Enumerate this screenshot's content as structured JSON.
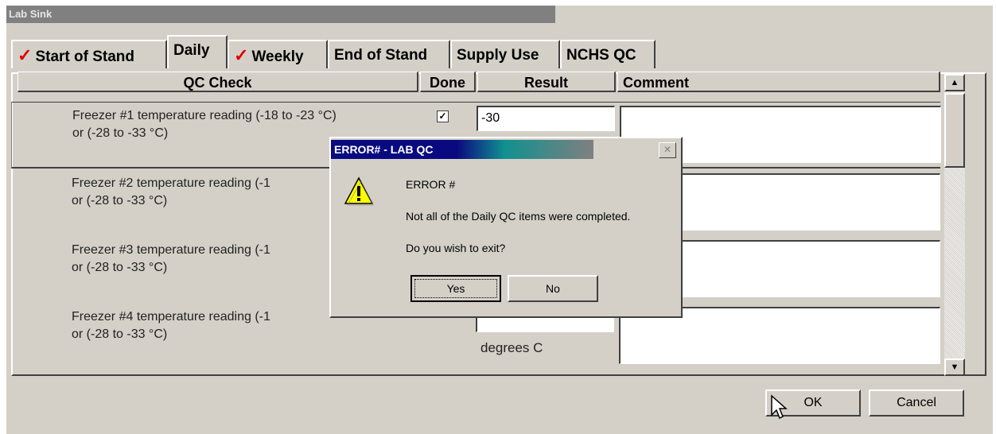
{
  "window": {
    "title": "Lab Sink"
  },
  "tabs": [
    {
      "label": "Start of Stand",
      "checked": true
    },
    {
      "label": "Daily",
      "checked": false,
      "active": true
    },
    {
      "label": "Weekly",
      "checked": true
    },
    {
      "label": "End of Stand",
      "checked": false
    },
    {
      "label": "Supply Use",
      "checked": false
    },
    {
      "label": "NCHS QC",
      "checked": false
    }
  ],
  "columns": {
    "qc_check": "QC Check",
    "done": "Done",
    "result": "Result",
    "comment": "Comment"
  },
  "rows": [
    {
      "label_line1": "Freezer #1 temperature reading (-18 to -23 °C)",
      "label_line2": "or (-28 to -33 °C)",
      "done": true,
      "result": "-30",
      "units": ""
    },
    {
      "label_line1": "Freezer #2 temperature reading (-1",
      "label_line2": "or (-28 to -33 °C)",
      "done": false,
      "result": "",
      "units": ""
    },
    {
      "label_line1": "Freezer #3 temperature reading (-1",
      "label_line2": "or (-28 to -33 °C)",
      "done": false,
      "result": "",
      "units": ""
    },
    {
      "label_line1": "Freezer #4 temperature reading (-1",
      "label_line2": "or (-28 to -33 °C)",
      "done": false,
      "result": "",
      "units": "degrees C"
    }
  ],
  "footer": {
    "ok_label": "OK",
    "cancel_label": "Cancel"
  },
  "dialog": {
    "title": "ERROR#  - LAB QC",
    "line1": "ERROR #",
    "line2": "Not all of the Daily QC items were completed.",
    "line3": "Do you wish to exit?",
    "yes_label": "Yes",
    "no_label": "No",
    "close_glyph": "✕"
  },
  "icons": {
    "check": "red-checkmark-icon",
    "warning": "warning-icon",
    "cursor": "mouse-pointer-icon"
  },
  "colors": {
    "check": "#e00000",
    "dialog_title_start": "#0a0a80",
    "dialog_title_mid": "#109090"
  }
}
